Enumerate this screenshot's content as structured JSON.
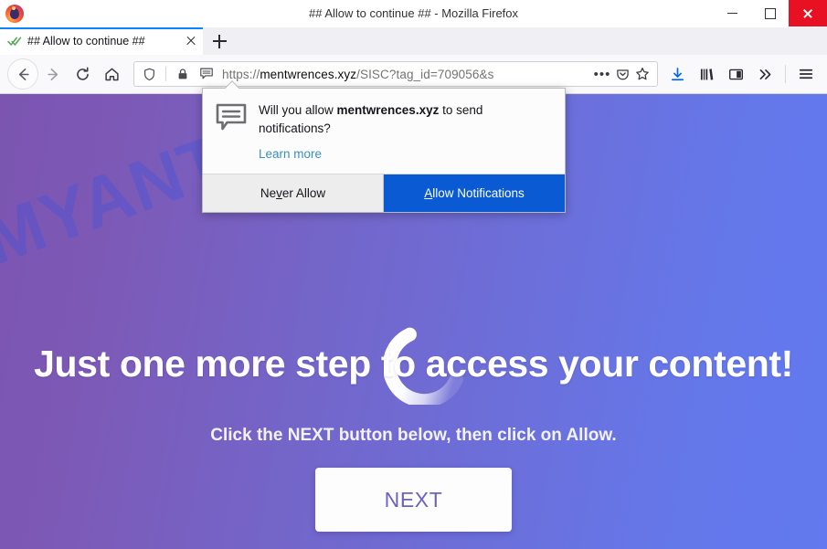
{
  "window": {
    "title": "## Allow to continue ## - Mozilla Firefox",
    "minimize_label": "Minimize",
    "maximize_label": "Maximize",
    "close_label": "Close",
    "app_icon": "firefox-logo-icon"
  },
  "tabs": {
    "items": [
      {
        "label": "## Allow to continue ##",
        "favicon": "green-double-check-icon",
        "close_label": "Close tab"
      }
    ],
    "new_tab_label": "New tab"
  },
  "toolbar": {
    "back_label": "Back",
    "forward_label": "Forward",
    "reload_label": "Reload",
    "home_label": "Home",
    "downloads_label": "Downloads",
    "library_label": "Library",
    "sidebar_label": "Sidebars",
    "overflow_label": "More tools",
    "menu_label": "Open application menu"
  },
  "urlbar": {
    "scheme": "https://",
    "host": "mentwrences.xyz",
    "path": "/SISC?tag_id=709056&s",
    "full_url": "https://mentwrences.xyz/SISC?tag_id=709056&s",
    "shield_icon": "tracking-protection-shield-icon",
    "lock_icon": "padlock-icon",
    "permission_icon": "notification-bubble-icon",
    "page_actions_label": "•••",
    "pocket_label": "Save to Pocket",
    "bookmark_label": "Bookmark this page"
  },
  "doorhanger": {
    "icon": "notification-bubble-icon",
    "message_prefix": "Will you allow ",
    "message_host": "mentwrences.xyz",
    "message_suffix": " to send notifications?",
    "learn_more": "Learn more",
    "never_allow": {
      "before": "Ne",
      "key": "v",
      "after": "er Allow"
    },
    "allow": {
      "key": "A",
      "after": "llow Notifications"
    },
    "primary_color": "#0a5bd3"
  },
  "page": {
    "watermark": "MYANTISPYWARE.COM",
    "spinner_label": "loading-spinner",
    "headline": "Just one more step to access your content!",
    "subline": "Click the NEXT button below, then click on Allow.",
    "next_button": "NEXT",
    "gradient_start": "#7b55b0",
    "gradient_end": "#6279ef",
    "next_text_color": "#6c63c0"
  }
}
